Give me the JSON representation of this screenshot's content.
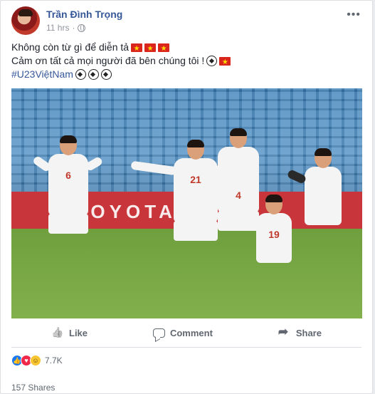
{
  "post": {
    "author": "Trần Đình Trọng",
    "time": "11 hrs",
    "privacy_icon": "globe-icon",
    "more_icon": "more-options-icon",
    "text_line1": "Không còn từ gì để diễn tả",
    "text_line2": "Cảm ơn tất cả mọi người đã bên chúng tôi !",
    "hashtag": "#U23ViệtNam",
    "emoji": {
      "flag": "vietnam-flag",
      "ball": "soccer-ball"
    }
  },
  "photo": {
    "board_text": "TOYOTA",
    "jersey_numbers": [
      "6",
      "21",
      "4",
      "19"
    ]
  },
  "actions": {
    "like": "Like",
    "comment": "Comment",
    "share": "Share"
  },
  "stats": {
    "reaction_count": "7.7K",
    "shares": "157 Shares",
    "reactions": [
      "like",
      "love",
      "haha"
    ]
  },
  "colors": {
    "link": "#365899",
    "muted": "#606770",
    "flag_red": "#da251d"
  }
}
